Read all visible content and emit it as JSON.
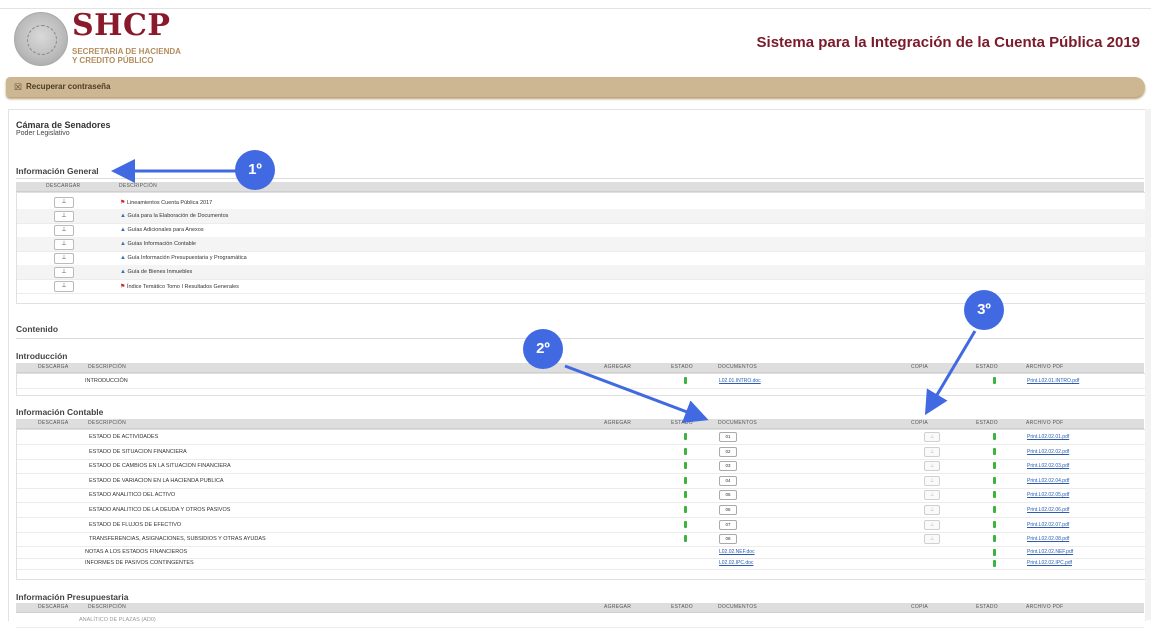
{
  "header": {
    "brand": "SHCP",
    "subtitle_line1": "SECRETARIA DE HACIENDA",
    "subtitle_line2": "Y CREDITO PÚBLICO",
    "system_title": "Sistema para la Integración de la Cuenta Pública 2019"
  },
  "menu_bar": {
    "icon": "☒",
    "label": "Recuperar contraseña"
  },
  "entity": {
    "name": "Cámara de Senadores",
    "branch": "Poder Legislativo"
  },
  "info_general": {
    "title": "Información General",
    "headers": [
      "DESCARGAR",
      "DESCRIPCIÓN"
    ],
    "download_glyph": "⊥",
    "rows": [
      {
        "icon": "pdf-icon",
        "glyph": "⚑",
        "desc": "Lineamientos Cuenta Pública 2017"
      },
      {
        "icon": "zip-icon",
        "glyph": "▲",
        "desc": "Guía para la Elaboración de Documentos"
      },
      {
        "icon": "zip-icon",
        "glyph": "▲",
        "desc": "Guías Adicionales para Anexos"
      },
      {
        "icon": "zip-icon",
        "glyph": "▲",
        "desc": "Guías Información Contable"
      },
      {
        "icon": "zip-icon",
        "glyph": "▲",
        "desc": "Guía Información Presupuestaria y Programática"
      },
      {
        "icon": "zip-icon",
        "glyph": "▲",
        "desc": "Guía de Bienes Inmuebles"
      },
      {
        "icon": "pdf-icon",
        "glyph": "⚑",
        "desc": "Índice Temático Tomo I Resultados Generales"
      }
    ]
  },
  "contenido": {
    "title": "Contenido"
  },
  "table_headers": [
    "DESCARGA",
    "DESCRIPCIÓN",
    "AGREGAR",
    "ESTADO",
    "DOCUMENTOS",
    "COPIA",
    "ESTADO",
    "ARCHIVO PDF"
  ],
  "introduccion": {
    "title": "Introducción",
    "rows": [
      {
        "desc": "INTRODUCCIÓN",
        "doc": "L02.01.INTRO.doc",
        "pdf": "Print.L02.01.INTRO.pdf"
      }
    ]
  },
  "contable": {
    "title": "Información Contable",
    "rows": [
      {
        "desc": "ESTADO DE ACTIVIDADES",
        "doc_btn": "01",
        "pdf": "Print.L02.02.01.pdf"
      },
      {
        "desc": "ESTADO DE SITUACION FINANCIERA",
        "doc_btn": "02",
        "pdf": "Print.L02.02.02.pdf"
      },
      {
        "desc": "ESTADO DE CAMBIOS EN LA SITUACION FINANCIERA",
        "doc_btn": "03",
        "pdf": "Print.L02.02.03.pdf"
      },
      {
        "desc": "ESTADO DE VARIACION EN LA HACIENDA PUBLICA",
        "doc_btn": "04",
        "pdf": "Print.L02.02.04.pdf"
      },
      {
        "desc": "ESTADO ANALITICO DEL ACTIVO",
        "doc_btn": "05",
        "pdf": "Print.L02.02.05.pdf"
      },
      {
        "desc": "ESTADO ANALITICO DE LA DEUDA Y OTROS PASIVOS",
        "doc_btn": "06",
        "pdf": "Print.L02.02.06.pdf"
      },
      {
        "desc": "ESTADO DE FLUJOS DE EFECTIVO",
        "doc_btn": "07",
        "pdf": "Print.L02.02.07.pdf"
      },
      {
        "desc": "TRANSFERENCIAS, ASIGNACIONES, SUBSIDIOS Y OTRAS AYUDAS",
        "doc_btn": "08",
        "pdf": "Print.L02.02.08.pdf"
      }
    ],
    "link_rows": [
      {
        "desc": "NOTAS A LOS ESTADOS FINANCIEROS",
        "doc": "L02.02.NEF.doc",
        "pdf": "Print.L02.02.NEF.pdf"
      },
      {
        "desc": "INFORMES DE PASIVOS CONTINGENTES",
        "doc": "L02.02.IPC.doc",
        "pdf": "Print.L02.02.IPC.pdf"
      }
    ]
  },
  "presupuestaria": {
    "title": "Información Presupuestaria",
    "first_row": "ANALÍTICO DE PLAZAS (AD0)"
  },
  "callouts": [
    "1º",
    "2º",
    "3º"
  ]
}
